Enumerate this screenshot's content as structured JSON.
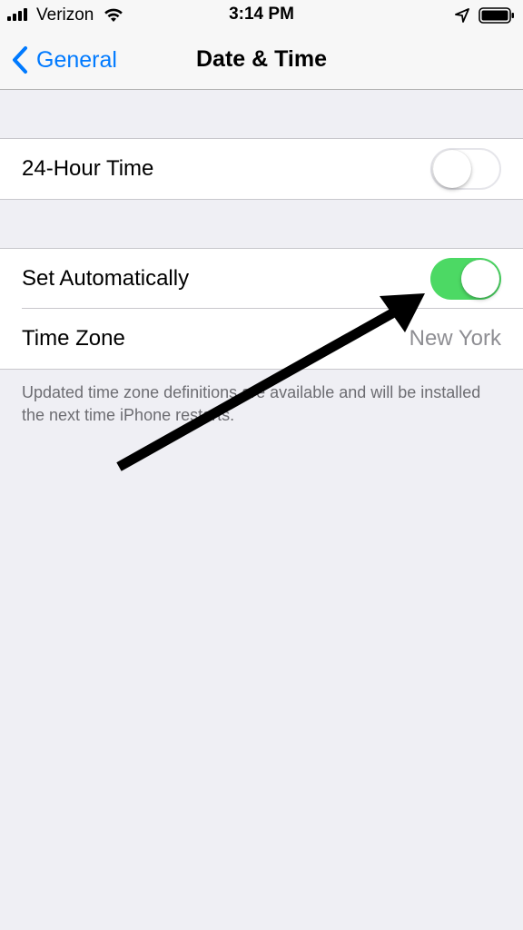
{
  "status_bar": {
    "carrier": "Verizon",
    "time": "3:14 PM"
  },
  "nav": {
    "back_label": "General",
    "title": "Date & Time"
  },
  "group1": {
    "rows": [
      {
        "label": "24-Hour Time",
        "toggle": "off"
      }
    ]
  },
  "group2": {
    "rows": [
      {
        "label": "Set Automatically",
        "toggle": "on"
      },
      {
        "label": "Time Zone",
        "value": "New York"
      }
    ]
  },
  "footnote": "Updated time zone definitions are available and will be installed the next time iPhone restarts.",
  "colors": {
    "accent": "#007aff",
    "toggle_on": "#4cd964",
    "background": "#efeff4"
  },
  "icons": [
    "signal-bars-icon",
    "wifi-icon",
    "location-arrow-icon",
    "battery-icon",
    "chevron-left-icon"
  ]
}
